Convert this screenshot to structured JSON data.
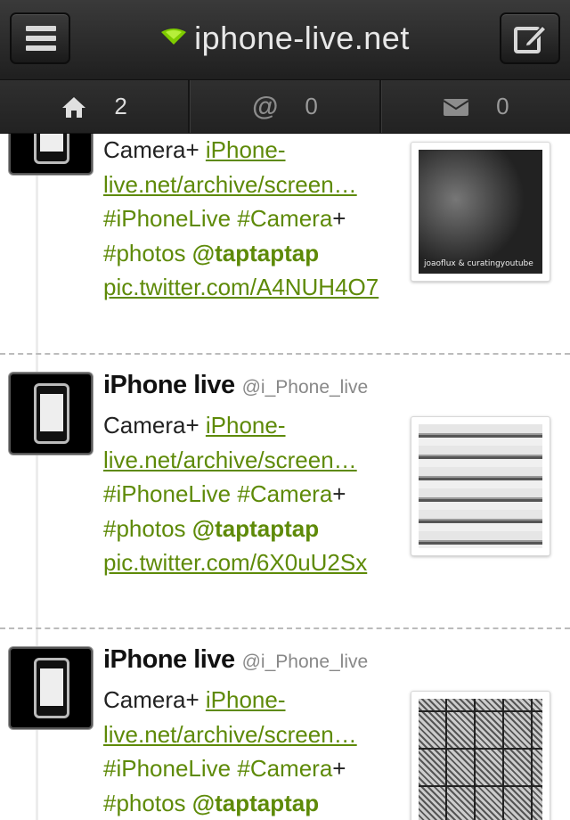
{
  "header": {
    "title": "iphone-live.net",
    "brand_color": "#6cb800"
  },
  "tabs": [
    {
      "icon": "home-icon",
      "count": "2"
    },
    {
      "icon": "at-mention-icon",
      "count": "0"
    },
    {
      "icon": "mail-icon",
      "count": "0"
    }
  ],
  "tweets": [
    {
      "name": "",
      "handle": "",
      "text_prefix": "Camera+",
      "link": "iPhone-live.net/archive/screen…",
      "tag1": "#iPhoneLive",
      "tag2": "#Camera",
      "tag2_suffix": "+",
      "tag3": "#photos",
      "mention": "@taptaptap",
      "pic_link": "pic.twitter.com/A4NUH4O7",
      "image_caption": "joaoflux & curatingyoutube"
    },
    {
      "name": "iPhone live",
      "handle": "@i_Phone_live",
      "text_prefix": "Camera+",
      "link": "iPhone-live.net/archive/screen…",
      "tag1": "#iPhoneLive",
      "tag2": "#Camera",
      "tag2_suffix": "+",
      "tag3": "#photos",
      "mention": "@taptaptap",
      "pic_link": "pic.twitter.com/6X0uU2Sx"
    },
    {
      "name": "iPhone live",
      "handle": "@i_Phone_live",
      "text_prefix": "Camera+",
      "link": "iPhone-live.net/archive/screen…",
      "tag1": "#iPhoneLive",
      "tag2": "#Camera",
      "tag2_suffix": "+",
      "tag3": "#photos",
      "mention": "@taptaptap"
    }
  ]
}
